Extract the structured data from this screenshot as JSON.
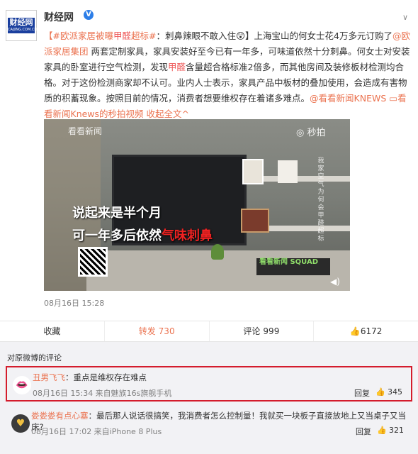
{
  "post": {
    "username": "财经网",
    "avatar_text": "财经网",
    "avatar_sub": "CAIJING.COM.CN",
    "content": {
      "tag": "【#欧派家居被曝",
      "tag_hl": "甲醛",
      "tag2": "超标#",
      "t1": "：刺鼻辣眼不敢入住",
      "emoji": "😲",
      "t2": "】上海宝山的何女士花4万多元订购了",
      "mention": "@欧派家居集团",
      "t3": " 两套定制家具，家具安装好至今已有一年多，可味道依然十分刺鼻。何女士对安装家具的卧室进行空气检测，发现",
      "hl2": "甲醛",
      "t4": "含量超合格标准2倍多，而其他房间及装修板材检测均合格。对于这份检测商家却不认可。业内人士表示，家具产品中板材的叠加使用，会造成有害物质的积蓄现象。按照目前的情况，消费者想要维权存在着诸多难点。",
      "link1": "@看看新闻KNEWS",
      "link2": "看看新闻Knews的秒拍视频",
      "collapse": "收起全文",
      "collapse_arrow": "^"
    },
    "video": {
      "watermark_left": "看看新闻",
      "watermark_right": "秒拍",
      "vertical_text": "我家空气为何会甲醛超标",
      "caption1": "说起来是半个月",
      "caption2_a": "可一年多后依然",
      "caption2_b": "气味刺鼻",
      "badge": "看看新闻 SQUAD",
      "speaker": "◀)"
    },
    "date": "08月16日 15:28"
  },
  "actions": [
    {
      "label": "收藏",
      "count": ""
    },
    {
      "label": "转发",
      "count": "730"
    },
    {
      "label": "评论",
      "count": "999"
    },
    {
      "label": "6172",
      "count": ""
    }
  ],
  "comments": {
    "title": "对原微博的评论",
    "items": [
      {
        "name": "丑男飞飞",
        "text": "：重点是维权存在难点",
        "meta": "08月16日 15:34 来自魅族16s旗舰手机",
        "reply": "回复",
        "likes": "345"
      },
      {
        "name": "娄娄娄有点心塞",
        "text": "：最后那人说话很搞笑，我消费者怎么控制量！我就买一块板子直接放地上又当桌子又当床?",
        "meta": "08月16日 17:02 来自iPhone 8 Plus",
        "reply": "回复",
        "likes": "321"
      }
    ]
  }
}
